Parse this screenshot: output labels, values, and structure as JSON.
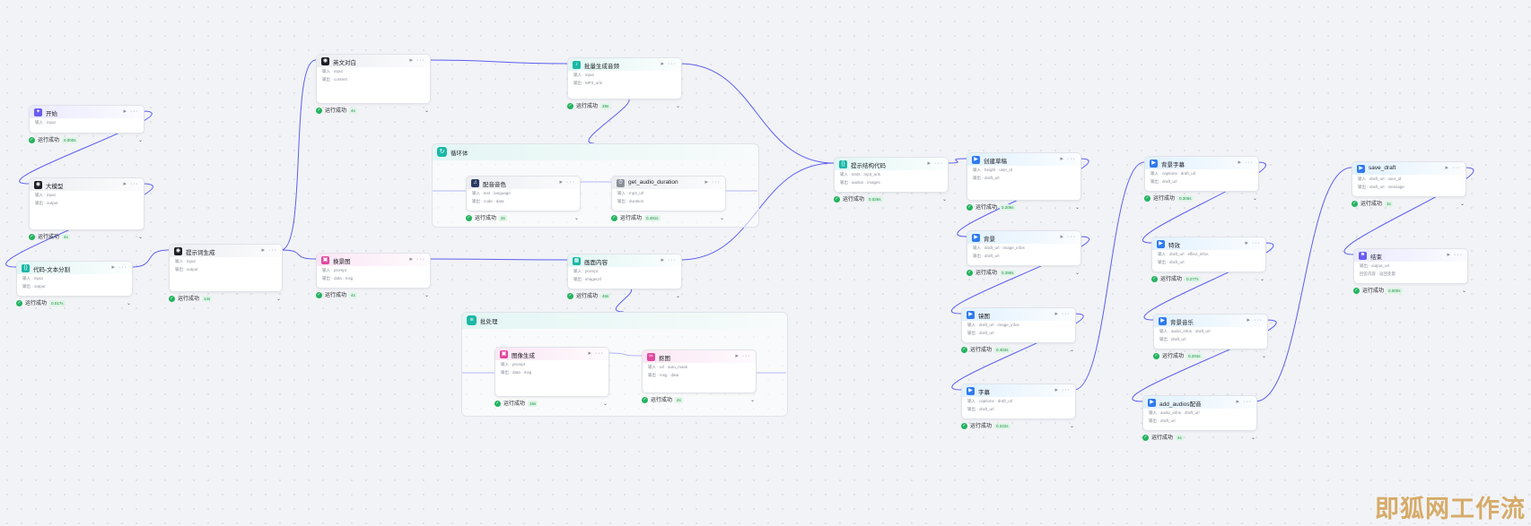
{
  "colors": {
    "edge": "#5b5ff0",
    "success": "#22b35e",
    "accent_teal": "#19b8a6"
  },
  "groups": {
    "loop": {
      "title": "循环体"
    },
    "batch": {
      "title": "批处理"
    }
  },
  "nodes": {
    "start": {
      "title": "开始",
      "icon": "robot-icon",
      "r1": "输入 · input"
    },
    "llm": {
      "title": "大模型",
      "icon": "model-icon",
      "r1": "输入 · input",
      "r2": "输出 · output"
    },
    "splitter": {
      "title": "代码-文本分割",
      "icon": "code-icon",
      "r1": "输入 · input",
      "r2": "输出 · output"
    },
    "prompt": {
      "title": "提示词生成",
      "icon": "model-icon",
      "r1": "输入 · input",
      "r2": "输出 · output"
    },
    "eng": {
      "title": "英文对白",
      "icon": "model-icon",
      "r1": "输入 · input",
      "r2": "输出 · content"
    },
    "voice": {
      "title": "批量生成音频",
      "icon": "audio-icon",
      "r1": "输入 · input",
      "r2": "输出 · MP3_urls"
    },
    "tts": {
      "title": "配音音色",
      "icon": "mic-icon",
      "r1": "输入 · text · language",
      "r2": "输出 · code · data"
    },
    "duration": {
      "title": "get_audio_duration",
      "icon": "clock-icon",
      "r1": "输入 · mp3_url",
      "r2": "输出 · duration"
    },
    "scene": {
      "title": "换景图",
      "icon": "image-icon",
      "r1": "输入 · prompt",
      "r2": "输出 · data · msg"
    },
    "frame": {
      "title": "画面内容",
      "icon": "canvas-icon",
      "r1": "输入 · prompt",
      "r2": "输出 · imageUrl"
    },
    "imggen": {
      "title": "图像生成",
      "icon": "image-icon",
      "r1": "输入 · prompt",
      "r2": "输出 · data · msg"
    },
    "cut": {
      "title": "抠图",
      "icon": "scissors-icon",
      "r1": "输入 · url · auto_mask",
      "r2": "输出 · msg · data"
    },
    "struct": {
      "title": "提示结构代码",
      "icon": "code-icon",
      "r1": "输入 · texts · mp3_urls",
      "r2": "输出 · audios · images"
    },
    "draft": {
      "title": "创建草稿",
      "icon": "draft-icon",
      "r1": "输入 · height · user_id",
      "r2": "输出 · draft_url"
    },
    "bg": {
      "title": "背景",
      "icon": "draft-icon",
      "r1": "输入 · draft_url · image_infos",
      "r2": "输出 · draft_url"
    },
    "title_img": {
      "title": "镜图",
      "icon": "draft-icon",
      "r1": "输入 · draft_url · image_infos",
      "r2": "输出 · draft_url"
    },
    "subtitle": {
      "title": "字幕",
      "icon": "draft-icon",
      "r1": "输入 · captions · draft_url",
      "r2": "输出 · draft_url"
    },
    "caption2": {
      "title": "背景字幕",
      "icon": "draft-icon",
      "r1": "输入 · captions · draft_url",
      "r2": "输出 · draft_url"
    },
    "effect": {
      "title": "特效",
      "icon": "draft-icon",
      "r1": "输入 · draft_url · effect_infos",
      "r2": "输出 · draft_url"
    },
    "bgm": {
      "title": "背景音乐",
      "icon": "draft-icon",
      "r1": "输入 · audio_infos · draft_url",
      "r2": "输出 · draft_url"
    },
    "addaudio": {
      "title": "add_audios配音",
      "icon": "draft-icon",
      "r1": "输入 · audio_infos · draft_url",
      "r2": "输出 · draft_url"
    },
    "save": {
      "title": "save_draft",
      "icon": "draft-icon",
      "r1": "输入 · draft_url · user_id",
      "r2": "输出 · draft_url · message"
    },
    "end": {
      "title": "结束",
      "icon": "flag-icon",
      "r1": "输出 · output_url",
      "r2": "回答内容 · 返回变量"
    }
  },
  "statuses": {
    "label": "运行成功",
    "start": "0.000s",
    "llm": "4s",
    "splitter": "0.017s",
    "prompt": "14s",
    "eng": "4s",
    "voice": "28s",
    "tts": "3s",
    "duration": "0.491s",
    "scene": "4s",
    "frame": "46s",
    "imggen": "16s",
    "cut": "4s",
    "struct": "0.026s",
    "draft": "0.206s",
    "bg": "0.390s",
    "title_img": "0.404s",
    "subtitle": "0.342s",
    "caption2": "0.305s",
    "effect": "0.277s",
    "bgm": "0.204s",
    "addaudio": "4s",
    "save": "1s",
    "end": "0.000s"
  },
  "watermark": "即狐网工作流"
}
